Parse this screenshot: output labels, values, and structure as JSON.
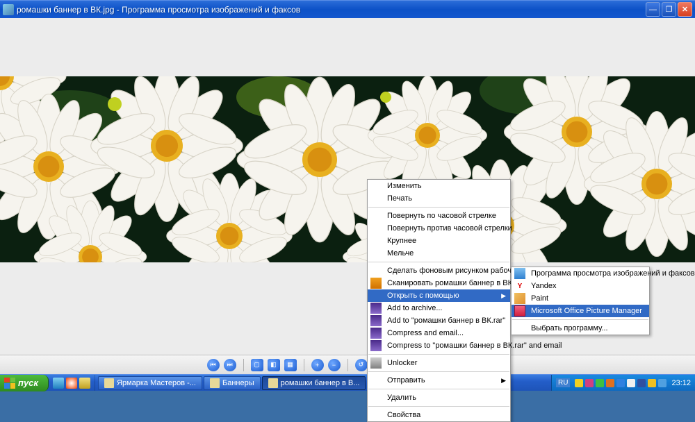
{
  "titlebar": {
    "title": "ромашки баннер в ВК.jpg - Программа просмотра изображений и факсов"
  },
  "contextMenu1": {
    "items": [
      {
        "label": "Изменить"
      },
      {
        "label": "Печать"
      },
      {
        "sep": true
      },
      {
        "label": "Повернуть по часовой стрелке"
      },
      {
        "label": "Повернуть против часовой стрелки"
      },
      {
        "label": "Крупнее"
      },
      {
        "label": "Мельче"
      },
      {
        "sep": true
      },
      {
        "label": "Сделать фоновым рисунком рабочего стола"
      },
      {
        "label": "Сканировать ромашки баннер в ВК.jpg",
        "icon": "orange"
      },
      {
        "label": "Открыть с помощью",
        "submenu": true,
        "highlight": true
      },
      {
        "label": "Add to archive...",
        "icon": "winrar"
      },
      {
        "label": "Add to \"ромашки баннер в ВК.rar\"",
        "icon": "winrar"
      },
      {
        "label": "Compress and email...",
        "icon": "winrar"
      },
      {
        "label": "Compress to \"ромашки баннер в ВК.rar\" and email",
        "icon": "winrar"
      },
      {
        "sep": true
      },
      {
        "label": "Unlocker",
        "icon": "lock"
      },
      {
        "sep": true
      },
      {
        "label": "Отправить",
        "submenu": true
      },
      {
        "sep": true
      },
      {
        "label": "Удалить"
      },
      {
        "sep": true
      },
      {
        "label": "Свойства"
      }
    ]
  },
  "contextMenu2": {
    "items": [
      {
        "label": "Программа просмотра изображений и факсов",
        "icon": "pv"
      },
      {
        "label": "Yandex",
        "icon": "y"
      },
      {
        "label": "Paint",
        "icon": "paint"
      },
      {
        "label": "Microsoft Office Picture Manager",
        "icon": "mspm",
        "highlight": true
      },
      {
        "sep": true
      },
      {
        "label": "Выбрать программу..."
      }
    ]
  },
  "taskbar": {
    "start": "пуск",
    "tasks": [
      {
        "label": "Ярмарка Мастеров -..."
      },
      {
        "label": "Баннеры"
      },
      {
        "label": "ромашки баннер в В...",
        "active": true
      }
    ],
    "lang": "RU",
    "clock": "23:12"
  }
}
